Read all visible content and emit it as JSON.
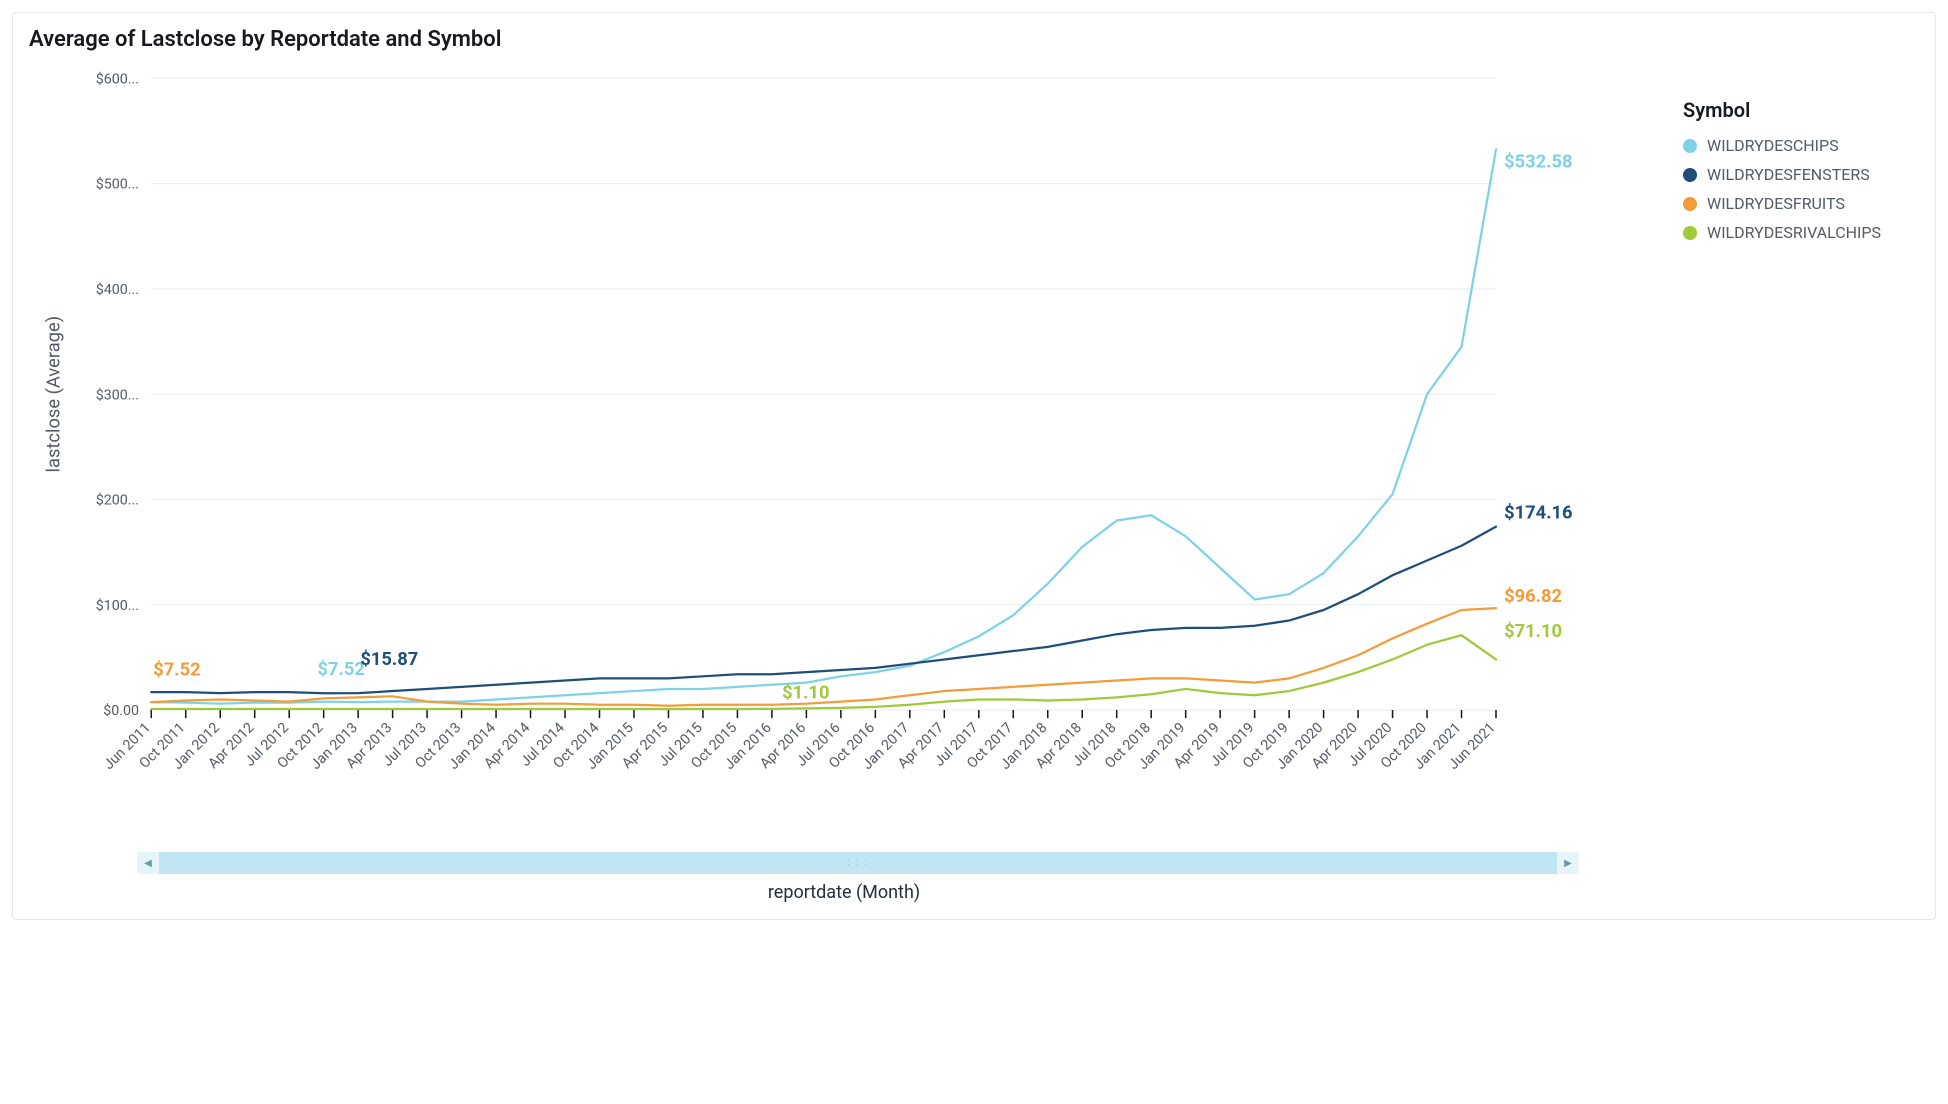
{
  "title": "Average of Lastclose by Reportdate and Symbol",
  "xlabel": "reportdate (Month)",
  "ylabel": "lastclose (Average)",
  "legend_title": "Symbol",
  "y_ticks": [
    "$0.00",
    "$100...",
    "$200...",
    "$300...",
    "$400...",
    "$500...",
    "$600..."
  ],
  "legend": [
    {
      "name": "WILDRYDESCHIPS",
      "color": "#7fd2e6"
    },
    {
      "name": "WILDRYDESFENSTERS",
      "color": "#1f4e79"
    },
    {
      "name": "WILDRYDESFRUITS",
      "color": "#f39c3a"
    },
    {
      "name": "WILDRYDESRIVALCHIPS",
      "color": "#9fc93a"
    }
  ],
  "labels": {
    "fruits_start": "$7.52",
    "chips_start": "$7.52",
    "fensters_early": "$15.87",
    "rival_mid": "$1.10",
    "chips_end": "$532.58",
    "fensters_end": "$174.16",
    "fruits_end": "$96.82",
    "rival_end": "$71.10"
  },
  "chart_data": {
    "type": "line",
    "title": "Average of Lastclose by Reportdate and Symbol",
    "xlabel": "reportdate (Month)",
    "ylabel": "lastclose (Average)",
    "ylim": [
      0,
      600
    ],
    "categories": [
      "Jun 2011",
      "Oct 2011",
      "Jan 2012",
      "Apr 2012",
      "Jul 2012",
      "Oct 2012",
      "Jan 2013",
      "Apr 2013",
      "Jul 2013",
      "Oct 2013",
      "Jan 2014",
      "Apr 2014",
      "Jul 2014",
      "Oct 2014",
      "Jan 2015",
      "Apr 2015",
      "Jul 2015",
      "Oct 2015",
      "Jan 2016",
      "Apr 2016",
      "Jul 2016",
      "Oct 2016",
      "Jan 2017",
      "Apr 2017",
      "Jul 2017",
      "Oct 2017",
      "Jan 2018",
      "Apr 2018",
      "Jul 2018",
      "Oct 2018",
      "Jan 2019",
      "Apr 2019",
      "Jul 2019",
      "Oct 2019",
      "Jan 2020",
      "Apr 2020",
      "Jul 2020",
      "Oct 2020",
      "Jan 2021",
      "Jun 2021"
    ],
    "series": [
      {
        "name": "WILDRYDESCHIPS",
        "color": "#7fd2e6",
        "values": [
          7.52,
          7,
          6,
          7,
          7,
          8,
          7.52,
          8,
          8,
          8,
          10,
          12,
          14,
          16,
          18,
          20,
          20,
          22,
          24,
          26,
          32,
          36,
          42,
          55,
          70,
          90,
          120,
          155,
          180,
          185,
          165,
          135,
          105,
          110,
          130,
          165,
          205,
          300,
          345,
          532.58
        ]
      },
      {
        "name": "WILDRYDESFENSTERS",
        "color": "#1f4e79",
        "values": [
          17,
          17,
          16,
          17,
          17,
          15.87,
          16,
          18,
          20,
          22,
          24,
          26,
          28,
          30,
          30,
          30,
          32,
          34,
          34,
          36,
          38,
          40,
          44,
          48,
          52,
          56,
          60,
          66,
          72,
          76,
          78,
          78,
          80,
          85,
          95,
          110,
          128,
          142,
          156,
          174.16
        ]
      },
      {
        "name": "WILDRYDESFRUITS",
        "color": "#f39c3a",
        "values": [
          7.52,
          9,
          10,
          9,
          8,
          11,
          12,
          13,
          8,
          6,
          5,
          6,
          6,
          5,
          5,
          4,
          5,
          5,
          5,
          6,
          8,
          10,
          14,
          18,
          20,
          22,
          24,
          26,
          28,
          30,
          30,
          28,
          26,
          30,
          40,
          52,
          68,
          82,
          95,
          96.82
        ]
      },
      {
        "name": "WILDRYDESRIVALCHIPS",
        "color": "#9fc93a",
        "values": [
          1,
          1,
          1,
          1,
          1,
          1,
          1,
          1,
          1,
          1,
          1,
          1,
          1,
          1,
          1,
          1,
          1,
          1,
          1.1,
          1.5,
          2,
          3,
          5,
          8,
          10,
          10,
          9,
          10,
          12,
          15,
          20,
          16,
          14,
          18,
          26,
          36,
          48,
          62,
          71.1,
          48
        ]
      }
    ]
  }
}
